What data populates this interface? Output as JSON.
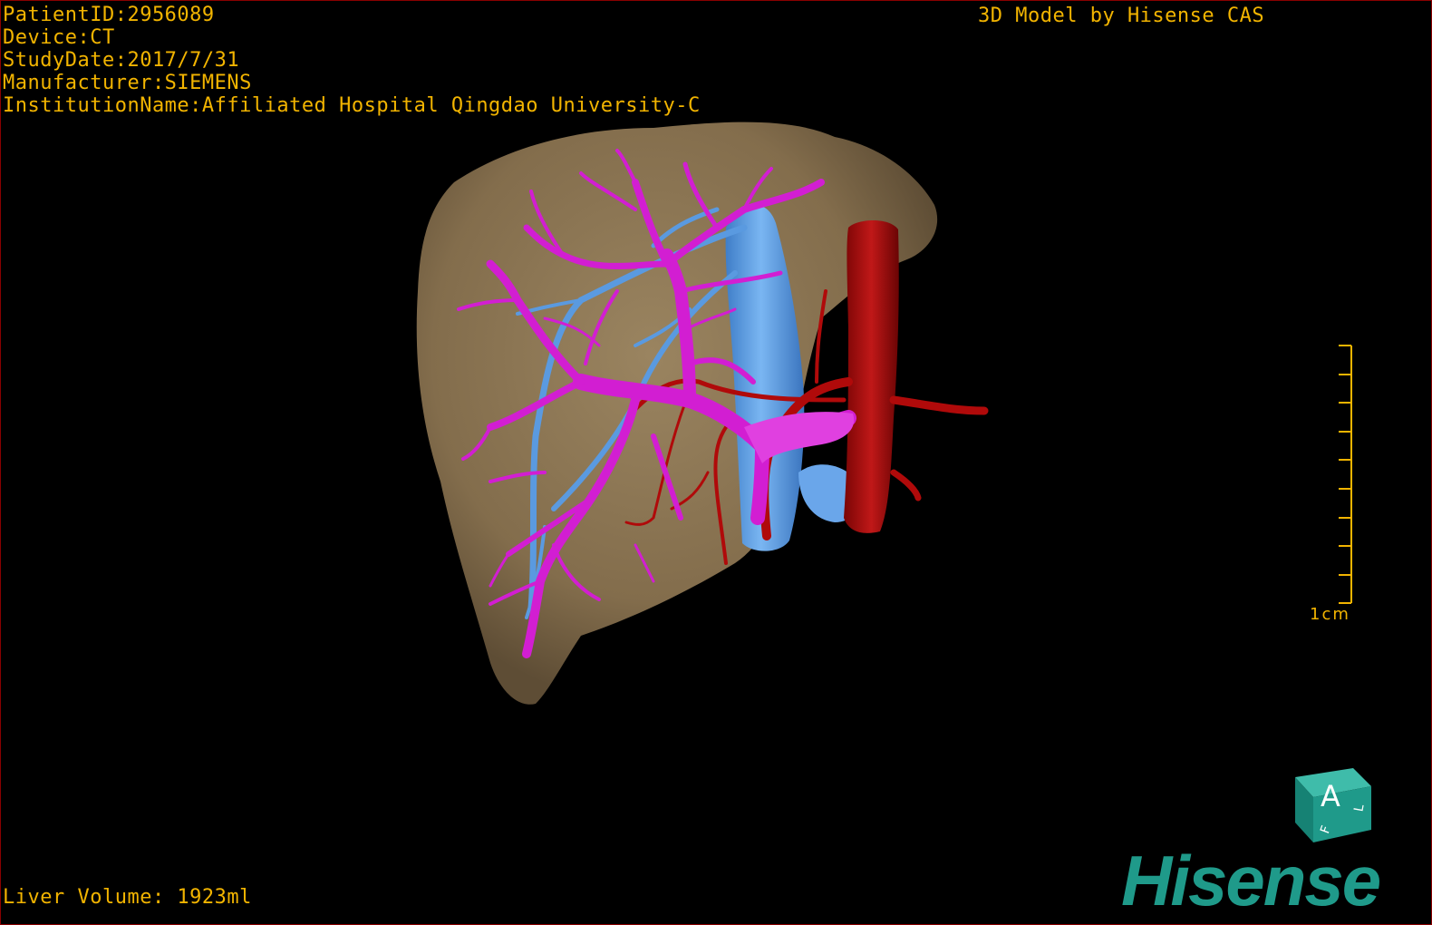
{
  "overlay": {
    "patient_id": "PatientID:2956089",
    "device": "Device:CT",
    "study_date": "StudyDate:2017/7/31",
    "manufacturer": "Manufacturer:SIEMENS",
    "institution": "InstitutionName:Affiliated Hospital Qingdao University-C",
    "model_credit": "3D Model by Hisense CAS",
    "liver_volume": "Liver Volume: 1923ml"
  },
  "scale_bar": {
    "label": "1cm"
  },
  "orientation_cube": {
    "front_letter": "A",
    "side_letter": "L",
    "bottom_letter": "F"
  },
  "brand": {
    "name": "Hisense"
  },
  "colors": {
    "text": "#f2b400",
    "liver": "#8a7552",
    "portal_vein": "#d21ed2",
    "hepatic_vein": "#5a9ae0",
    "artery": "#b00a0a",
    "brand": "#1f9a8a",
    "cube": "#1f9a8a"
  }
}
